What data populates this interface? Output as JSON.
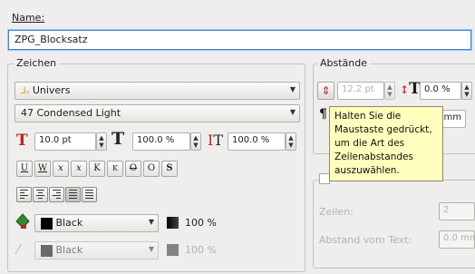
{
  "name_section": {
    "label": "Name:",
    "value": "ZPG_Blocksatz"
  },
  "zeichen": {
    "title": "Zeichen",
    "font_family": "Univers",
    "font_style": "47 Condensed Light",
    "font_size": "10.0 pt",
    "scale_horizontal": "100.0 %",
    "scale_vertical": "100.0 %",
    "style_buttons": [
      "U",
      "W",
      "x",
      "x",
      "K",
      "K",
      "O",
      "O",
      "S"
    ],
    "fill_color": "Black",
    "fill_shade": "100 %",
    "stroke_color": "Black",
    "stroke_shade": "100 %"
  },
  "abstaende": {
    "title": "Abstände",
    "line_spacing": "12.2 pt",
    "tracking": "0.0 %",
    "unit_value": "mm",
    "zeilen_label": "Zeilen:",
    "zeilen_value": "2",
    "abstand_label": "Abstand vom Text:",
    "abstand_value": "0.0 mm"
  },
  "tooltip": {
    "text": "Halten Sie die Maustaste gedrückt, um die Art des Zeilenabstandes auszuwählen."
  },
  "colors": {
    "accent": "#3a87d6",
    "tooltip_bg": "#fffebd",
    "text_T": "#c0201c",
    "fill_icon": "#2e8b2e"
  }
}
